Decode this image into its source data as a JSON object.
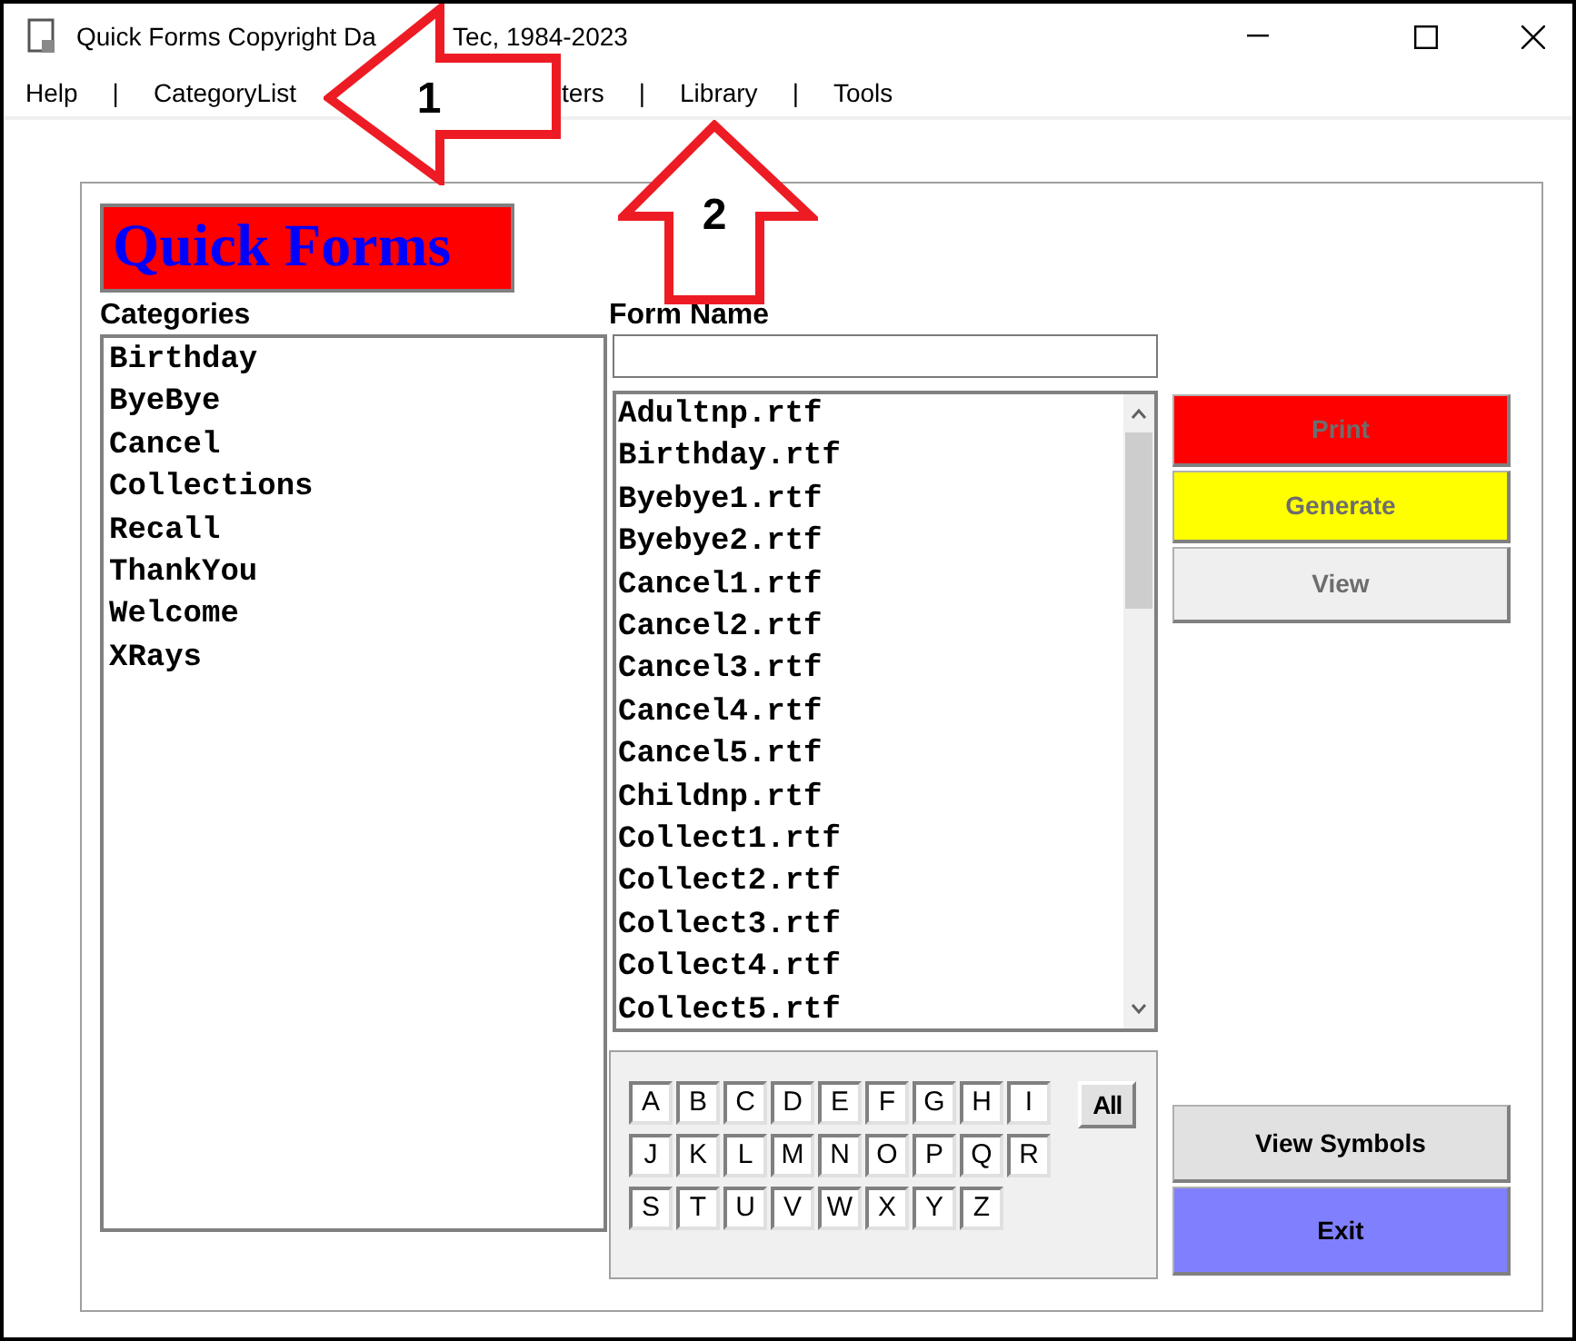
{
  "window": {
    "title_parts": [
      "Quick Forms Copyright Da",
      "Tec, 1984-2023"
    ]
  },
  "menu": [
    {
      "kind": "item",
      "label": "Help"
    },
    {
      "kind": "separator",
      "label": "|"
    },
    {
      "kind": "item",
      "label": "CategoryList"
    },
    {
      "kind": "gap",
      "label": "ters"
    },
    {
      "kind": "separator",
      "label": "|"
    },
    {
      "kind": "item",
      "label": "Library"
    },
    {
      "kind": "separator",
      "label": "|"
    },
    {
      "kind": "item",
      "label": "Tools"
    }
  ],
  "logo": "Quick Forms",
  "categories": {
    "label": "Categories",
    "items": [
      {
        "label": "Birthday",
        "selected": false
      },
      {
        "label": "ByeBye",
        "selected": false
      },
      {
        "label": "Cancel",
        "selected": false
      },
      {
        "label": "Collections",
        "selected": false
      },
      {
        "label": "Recall",
        "selected": false
      },
      {
        "label": "ThankYou",
        "selected": false
      },
      {
        "label": "Welcome",
        "selected": false
      },
      {
        "label": "XRays",
        "selected": false
      }
    ]
  },
  "form_name": {
    "label": "Form Name"
  },
  "files": [
    "Adultnp.rtf",
    "Birthday.rtf",
    "Byebye1.rtf",
    "Byebye2.rtf",
    "Cancel1.rtf",
    "Cancel2.rtf",
    "Cancel3.rtf",
    "Cancel4.rtf",
    "Cancel5.rtf",
    "Childnp.rtf",
    "Collect1.rtf",
    "Collect2.rtf",
    "Collect3.rtf",
    "Collect4.rtf",
    "Collect5.rtf"
  ],
  "letters": [
    [
      "A",
      "B",
      "C",
      "D",
      "E",
      "F",
      "G",
      "H",
      "I"
    ],
    [
      "J",
      "K",
      "L",
      "M",
      "N",
      "O",
      "P",
      "Q",
      "R"
    ],
    [
      "S",
      "T",
      "U",
      "V",
      "W",
      "X",
      "Y",
      "Z"
    ]
  ],
  "all_button": "All",
  "actions": [
    {
      "label": "Print",
      "color": "#ff0000",
      "disabled": true
    },
    {
      "label": "Generate",
      "color": "#ffff00",
      "disabled": true
    },
    {
      "label": "View",
      "color": "#efefef",
      "disabled": true
    }
  ],
  "bottom_actions": [
    {
      "label": "View Symbols",
      "color": "#e1e1e1",
      "disabled": false
    },
    {
      "label": "Exit",
      "color": "#8080ff",
      "disabled": false
    }
  ],
  "annotations": [
    {
      "label": "1",
      "kind": "left"
    },
    {
      "label": "2",
      "kind": "up"
    }
  ]
}
